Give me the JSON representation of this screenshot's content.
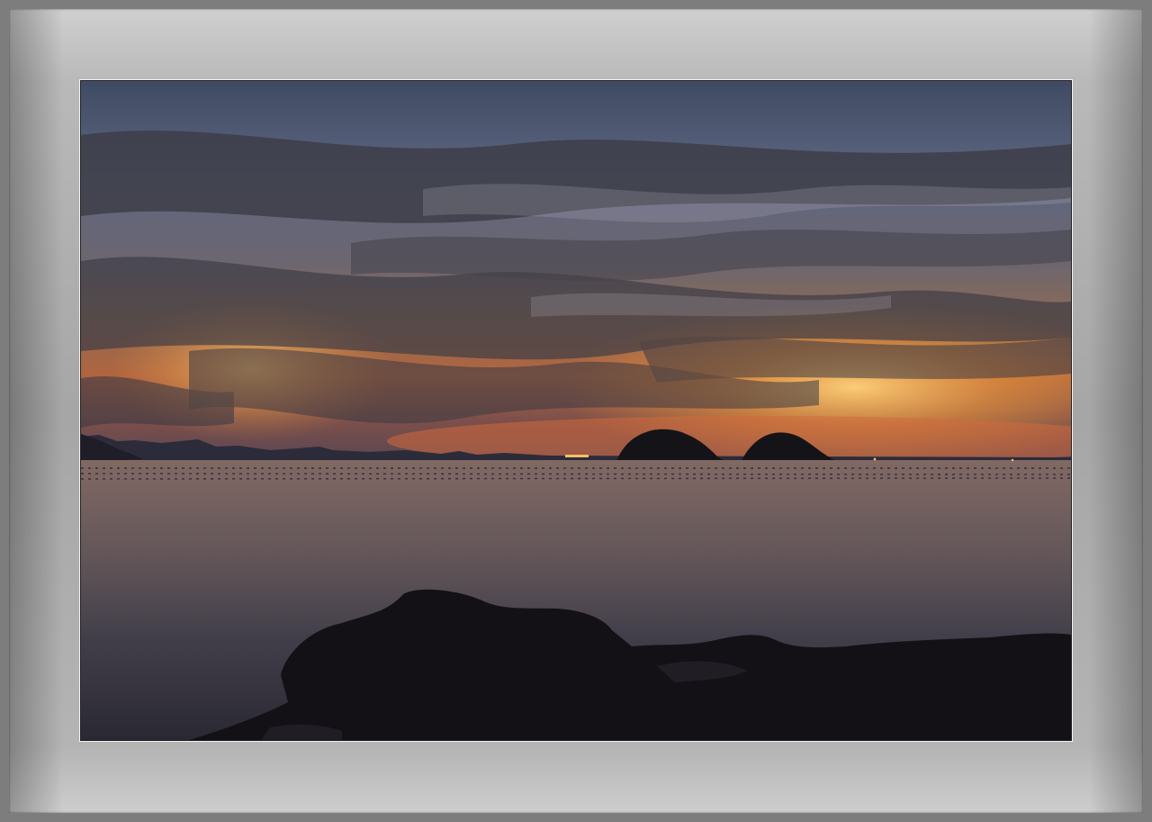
{
  "photo": {
    "subject": "sunset-seascape",
    "colors": {
      "sky_top": "#4d5d7a",
      "sky_mid": "#6b6a78",
      "glow": "#f2a23c",
      "horizon": "#c9573b",
      "water": "#4a4650",
      "rocks": "#151318",
      "mat": "#b3b3b3"
    }
  }
}
